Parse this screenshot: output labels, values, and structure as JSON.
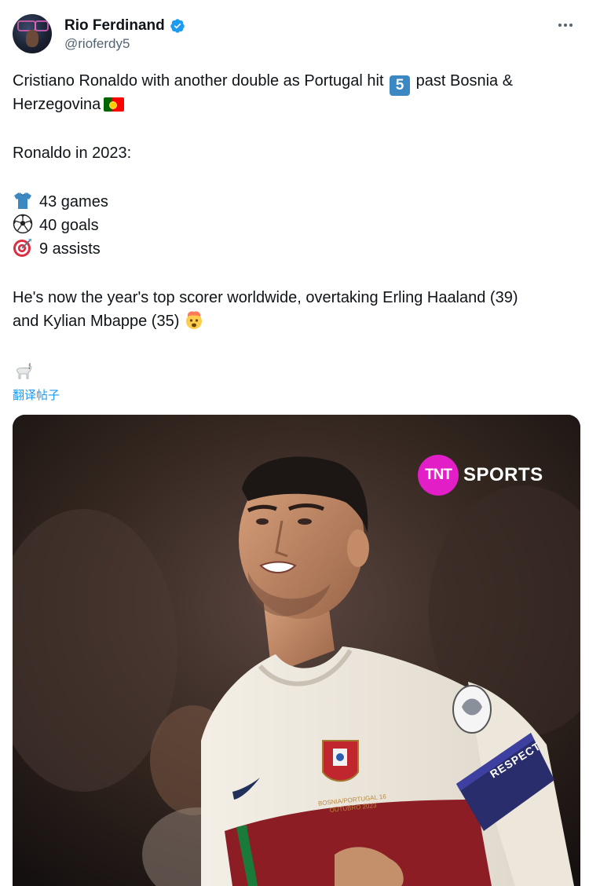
{
  "tweet": {
    "author": {
      "display_name": "Rio Ferdinand",
      "handle": "@rioferdy5",
      "verified": true
    },
    "text": {
      "line1_pre": "Cristiano Ronaldo with another double as Portugal hit",
      "line1_key": "5",
      "line1_post": "past Bosnia &",
      "line2": "Herzegovina",
      "heading": "Ronaldo in 2023:",
      "stat_games": "43 games",
      "stat_goals": "40 goals",
      "stat_assists": "9 assists",
      "line_scorer1": "He's now the year's top scorer worldwide, overtaking Erling Haaland (39)",
      "line_scorer2": "and Kylian Mbappe (35)"
    },
    "translate_label": "翻译帖子",
    "media": {
      "logo_tnt": "TNT",
      "logo_sports": "SPORTS",
      "armband": "RESPECT",
      "shirt_text": "BOSNIA/PORTUGAL 16 OUTUBRO 2023"
    },
    "icons": {
      "verified": "verified-badge-icon",
      "more": "more-options-icon",
      "flag": "portugal-flag-icon",
      "shirt": "t-shirt-emoji",
      "ball": "soccer-ball-emoji",
      "target": "direct-hit-emoji",
      "mindblown": "exploding-head-emoji",
      "goat": "goat-emoji"
    },
    "colors": {
      "accent": "#1d9bf0",
      "text": "#0f1419",
      "muted": "#536471",
      "tnt": "#e21ec6"
    }
  }
}
